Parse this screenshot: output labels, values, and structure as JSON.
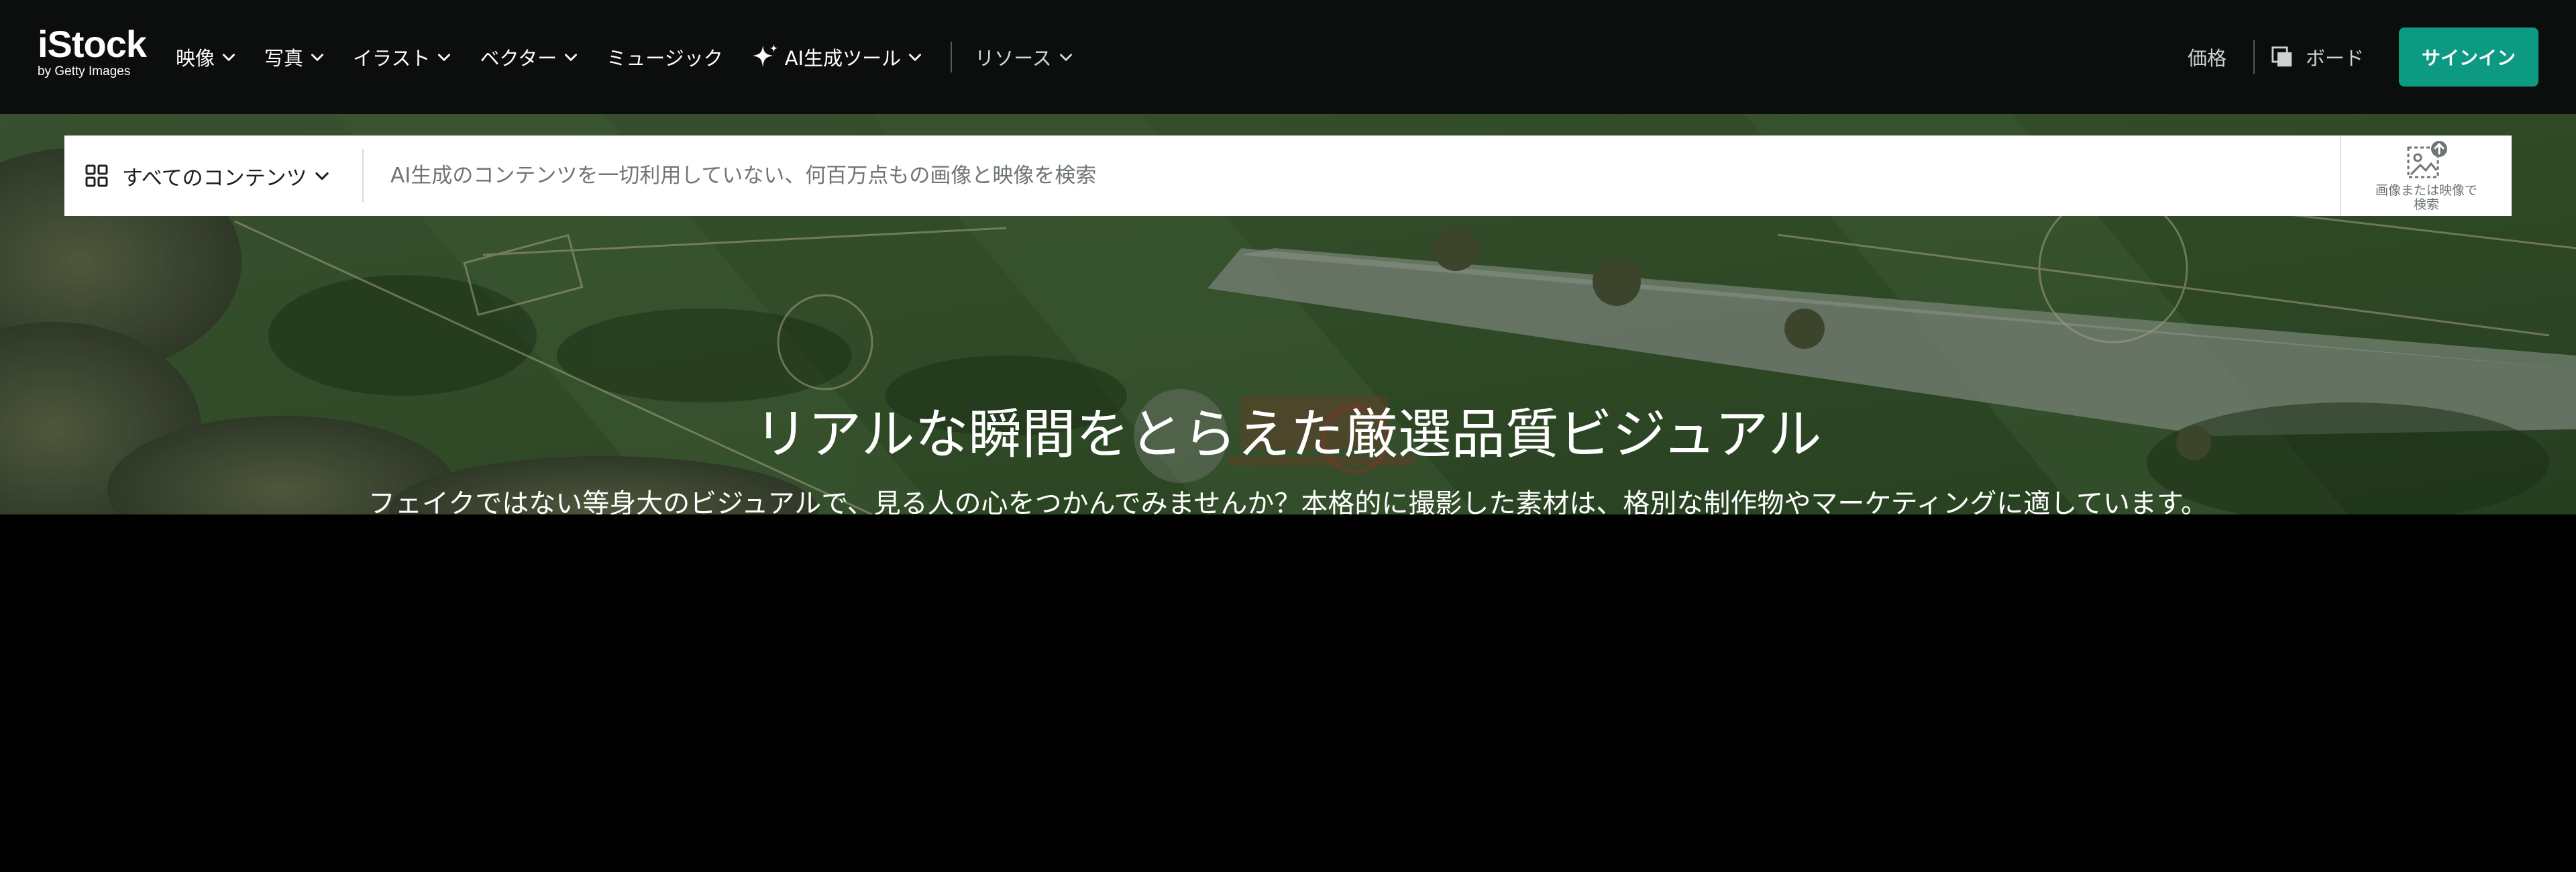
{
  "header": {
    "logo": {
      "main": "iStock",
      "sub": "by Getty Images"
    },
    "nav": [
      {
        "label": "映像",
        "has_dropdown": true
      },
      {
        "label": "写真",
        "has_dropdown": true
      },
      {
        "label": "イラスト",
        "has_dropdown": true
      },
      {
        "label": "ベクター",
        "has_dropdown": true
      },
      {
        "label": "ミュージック",
        "has_dropdown": false
      },
      {
        "label": "AI生成ツール",
        "has_dropdown": true,
        "icon": "sparkle-icon"
      },
      {
        "label": "リソース",
        "has_dropdown": true
      }
    ],
    "price_label": "価格",
    "board_label": "ボード",
    "signin_label": "サインイン",
    "colors": {
      "background": "#0c0d0d",
      "accent": "#0c9a82"
    }
  },
  "search": {
    "filter_label": "すべてのコンテンツ",
    "placeholder": "AI生成のコンテンツを一切利用していない、何百万点もの画像と映像を検索",
    "image_search_label": "画像または映像で検索"
  },
  "hero": {
    "title": "リアルな瞬間をとらえた厳選品質ビジュアル",
    "subtitle": "フェイクではない等身大のビジュアルで、見る人の心をつかんでみませんか？本格的に撮影した素材は、格別な制作物やマーケティングに適しています。"
  }
}
